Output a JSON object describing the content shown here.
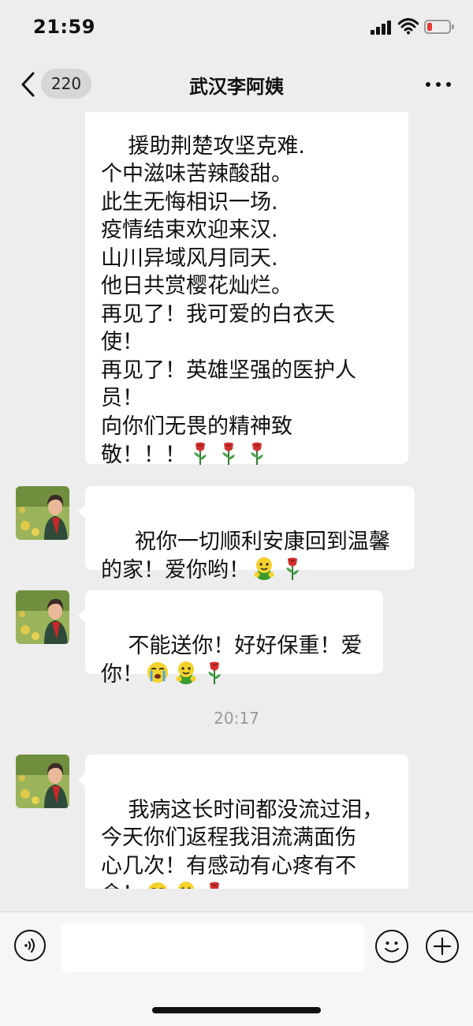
{
  "status_bar": {
    "time": "21:59"
  },
  "nav": {
    "badge_count": "220",
    "title": "武汉李阿姨"
  },
  "messages": [
    {
      "sender": "other",
      "partial_top": true,
      "text": "援助荆楚攻坚克难.\n个中滋味苦辣酸甜。\n此生无悔相识一场.\n疫情结束欢迎来汉.\n山川异域风月同天.\n他日共赏樱花灿烂。\n再见了！我可爱的白衣天\n使！\n再见了！英雄坚强的医护人\n员！\n向你们无畏的精神致\n敬！！！",
      "emojis": [
        "rose-icon",
        "rose-icon",
        "rose-icon"
      ]
    },
    {
      "sender": "other",
      "text": " 祝你一切顺利安康回到温馨\n的家！爱你哟！",
      "emojis": [
        "hug-icon",
        "rose-icon"
      ]
    },
    {
      "sender": "other",
      "text": "不能送你！好好保重！爱\n你！",
      "emojis": [
        "crying-icon",
        "hug-icon",
        "rose-icon"
      ]
    },
    {
      "sender": "other",
      "text": "我病这长时间都没流过泪，\n今天你们返程我泪流满面伤\n心几次！有感动有心疼有不\n舍！",
      "emojis": [
        "crying-icon",
        "hug-icon",
        "rose-icon"
      ]
    }
  ],
  "timestamp": "20:17",
  "input": {
    "placeholder": ""
  },
  "colors": {
    "background": "#ededed",
    "bubble": "#ffffff",
    "timestamp": "#999999",
    "battery_low": "#e53935"
  }
}
